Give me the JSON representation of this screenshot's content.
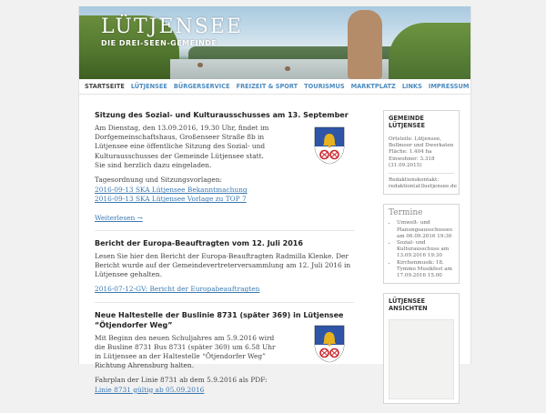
{
  "header": {
    "title": "LÜTJENSEE",
    "subtitle": "DIE DREI-SEEN-GEMEINDE"
  },
  "nav": {
    "items": [
      {
        "label": "STARTSEITE",
        "active": true
      },
      {
        "label": "LÜTJENSEE"
      },
      {
        "label": "BÜRGERSERVICE"
      },
      {
        "label": "FREIZEIT & SPORT"
      },
      {
        "label": "TOURISMUS"
      },
      {
        "label": "MARKTPLATZ"
      },
      {
        "label": "LINKS"
      },
      {
        "label": "IMPRESSUM"
      }
    ]
  },
  "posts": [
    {
      "title": "Sitzung des Sozial- und Kulturausschusses am 13. September",
      "p1": "Am Dienstag, den 13.09.2016, 19.30 Uhr, findet im Dorfgemeinschaftshaus, Großenseer Straße 8b in Lütjensee eine öffentliche Sitzung des Sozial- und Kulturausschusses der Gemeinde Lütjensee statt.",
      "p1b": "Sie sind herzlich dazu eingeladen.",
      "p2": "Tagesordnung und Sitzungsvorlagen:",
      "link1": "2016-09-13 SKA Lütjensee Bekanntmachung",
      "link2": "2016-09-13 SKA Lütjensee Vorlage zu TOP 7",
      "more": "Weiterlesen →"
    },
    {
      "title": "Bericht der Europa-Beauftragten vom 12. Juli 2016",
      "p1": "Lesen Sie hier den Bericht der Europa-Beauftragten Radmilla Klenke. Der Bericht wurde auf der Gemeindevertreterversammlung am 12. Juli 2016 in Lütjensee gehalten.",
      "link1": "2016-07-12-GV: Bericht der Europabeauftragten"
    },
    {
      "title": "Neue Haltestelle der Buslinie 8731 (später 369) in Lütjensee “Ötjendorfer Weg”",
      "p1": "Mit Beginn des neuen Schuljahres am 5.9.2016 wird die Busline 8731 Bus 8731 (später 369) um 6.58 Uhr in Lütjensee an der Haltestelle “Ötjendorfer Weg” Richtung Ahrensburg halten.",
      "p2": "Fahrplan der Linie 8731 ab dem 5.9.2016 als PDF: ",
      "link1": "Linie 8731 gültig ab 05.09.2016"
    }
  ],
  "sidebar": {
    "gemeinde": {
      "title": "GEMEINDE LÜTJENSEE",
      "ortsteile": "Ortsteile: Lütjensee, Bollmoor und Dwerkaten",
      "flaeche": "Fläche: 1.404 ha",
      "einwohner": "Einwohner: 3.318 (31.09.2015)",
      "kontakt": "Redaktionskontakt: redaktion(at)luetjensee.de"
    },
    "termine": {
      "title": "Termine",
      "items": [
        "Umwelt- und Planungsausschusses am 06.09.2016 19:30",
        "Sozial- und Kulturausschuss am 13.09.2016 19:30",
        "Kirchenmusik: 18. Tymmo Musikfest am 17.09.2016 15.00"
      ]
    },
    "ansichten": {
      "title": "LÜTJENSEE ANSICHTEN"
    }
  },
  "colors": {
    "link": "#3b79b2",
    "nav": "#4c8bbf",
    "coat_blue": "#2e55a6",
    "coat_red": "#c8272d",
    "coat_gold": "#e7b21d"
  }
}
